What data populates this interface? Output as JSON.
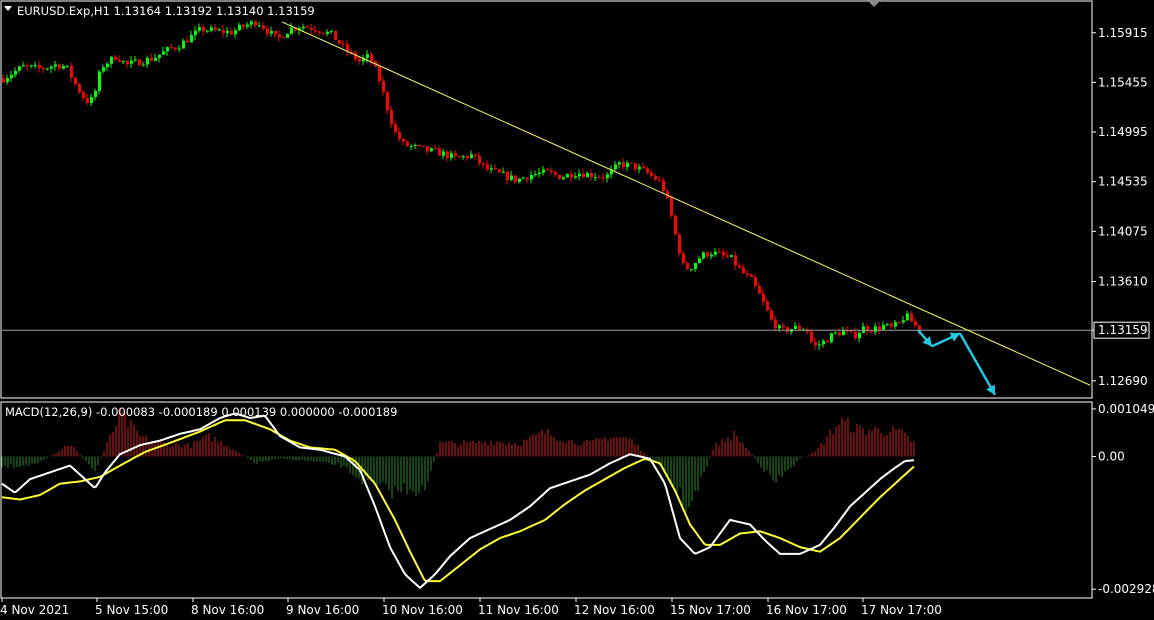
{
  "header": {
    "symbol_line": "EURUSD.Exp,H1  1.13164 1.13192 1.13140 1.13159"
  },
  "macd_header": "MACD(12,26,9) -0.000083 -0.000189 0.000139 0.000000 -0.000189",
  "colors": {
    "background": "#000000",
    "bull": "#00ff00",
    "bear": "#ff0000",
    "trendline": "#ffff66",
    "arrow": "#22c8e0",
    "macd_line": "#ffffff",
    "signal_line": "#ffff33",
    "hist_pos": "#d02020",
    "hist_neg": "#2a8a2a",
    "grid_border": "#ffffff"
  },
  "chart_data": [
    {
      "type": "candlestick",
      "title": "EURUSD.Exp,H1",
      "last_price": "1.13159",
      "ylim": [
        1.1254,
        1.162
      ],
      "y_ticks": [
        "1.15915",
        "1.15455",
        "1.14995",
        "1.14535",
        "1.14075",
        "1.13610",
        "1.13159",
        "1.12690"
      ],
      "x_ticks": [
        "4 Nov 2021",
        "5 Nov 15:00",
        "8 Nov 16:00",
        "9 Nov 16:00",
        "10 Nov 16:00",
        "11 Nov 16:00",
        "12 Nov 16:00",
        "15 Nov 17:00",
        "16 Nov 17:00",
        "17 Nov 17:00"
      ],
      "close_path": [
        [
          0,
          1.1548
        ],
        [
          12,
          1.1555
        ],
        [
          22,
          1.156
        ],
        [
          40,
          1.1558
        ],
        [
          55,
          1.1562
        ],
        [
          65,
          1.156
        ],
        [
          75,
          1.1542
        ],
        [
          85,
          1.1528
        ],
        [
          92,
          1.153
        ],
        [
          100,
          1.156
        ],
        [
          115,
          1.157
        ],
        [
          125,
          1.1562
        ],
        [
          140,
          1.1565
        ],
        [
          152,
          1.1568
        ],
        [
          165,
          1.1575
        ],
        [
          178,
          1.158
        ],
        [
          190,
          1.1588
        ],
        [
          200,
          1.1595
        ],
        [
          215,
          1.1593
        ],
        [
          230,
          1.1592
        ],
        [
          243,
          1.1598
        ],
        [
          256,
          1.1602
        ],
        [
          268,
          1.1592
        ],
        [
          276,
          1.1585
        ],
        [
          288,
          1.1595
        ],
        [
          300,
          1.1598
        ],
        [
          315,
          1.1595
        ],
        [
          330,
          1.159
        ],
        [
          345,
          1.1575
        ],
        [
          358,
          1.1565
        ],
        [
          368,
          1.157
        ],
        [
          378,
          1.1548
        ],
        [
          385,
          1.1525
        ],
        [
          393,
          1.15
        ],
        [
          402,
          1.1488
        ],
        [
          415,
          1.1485
        ],
        [
          428,
          1.1482
        ],
        [
          440,
          1.148
        ],
        [
          455,
          1.1475
        ],
        [
          470,
          1.1478
        ],
        [
          485,
          1.1465
        ],
        [
          500,
          1.146
        ],
        [
          515,
          1.1455
        ],
        [
          530,
          1.146
        ],
        [
          545,
          1.1462
        ],
        [
          560,
          1.1458
        ],
        [
          575,
          1.1462
        ],
        [
          590,
          1.146
        ],
        [
          605,
          1.1458
        ],
        [
          618,
          1.147
        ],
        [
          632,
          1.1468
        ],
        [
          645,
          1.1462
        ],
        [
          660,
          1.1452
        ],
        [
          668,
          1.143
        ],
        [
          675,
          1.14
        ],
        [
          683,
          1.1372
        ],
        [
          690,
          1.1375
        ],
        [
          700,
          1.1385
        ],
        [
          710,
          1.1388
        ],
        [
          720,
          1.1385
        ],
        [
          730,
          1.1382
        ],
        [
          740,
          1.137
        ],
        [
          750,
          1.1362
        ],
        [
          760,
          1.1345
        ],
        [
          770,
          1.1325
        ],
        [
          780,
          1.1315
        ],
        [
          792,
          1.1318
        ],
        [
          805,
          1.1318
        ],
        [
          812,
          1.13
        ],
        [
          822,
          1.1305
        ],
        [
          832,
          1.1312
        ],
        [
          842,
          1.1315
        ],
        [
          852,
          1.131
        ],
        [
          862,
          1.1318
        ],
        [
          872,
          1.1317
        ],
        [
          882,
          1.132
        ],
        [
          890,
          1.1318
        ],
        [
          898,
          1.1322
        ],
        [
          904,
          1.133
        ],
        [
          912,
          1.1322
        ],
        [
          918,
          1.1316
        ]
      ],
      "trendline": [
        [
          282,
          1.16015
        ],
        [
          1090,
          1.1265
        ]
      ],
      "projection_arrows": [
        [
          [
            918,
            1.1316
          ],
          [
            932,
            1.1301
          ]
        ],
        [
          [
            932,
            1.1301
          ],
          [
            960,
            1.1313
          ]
        ],
        [
          [
            960,
            1.1313
          ],
          [
            995,
            1.1256
          ]
        ]
      ]
    },
    {
      "type": "macd",
      "title": "MACD(12,26,9)",
      "ylim": [
        -0.0031,
        0.00118
      ],
      "y_ticks": [
        "0.001049",
        "0.00",
        "-0.002928"
      ],
      "zero_level": "0.00",
      "histogram_path": [
        [
          2,
          -0.00025
        ],
        [
          40,
          -0.00015
        ],
        [
          70,
          0.0003
        ],
        [
          95,
          -0.00035
        ],
        [
          120,
          0.00095
        ],
        [
          140,
          0.00045
        ],
        [
          160,
          0.0003
        ],
        [
          190,
          0.00025
        ],
        [
          210,
          0.00045
        ],
        [
          235,
          0.00015
        ],
        [
          255,
          -0.00015
        ],
        [
          280,
          -5e-05
        ],
        [
          310,
          -0.0001
        ],
        [
          340,
          -0.0002
        ],
        [
          370,
          -0.00065
        ],
        [
          395,
          -0.0008
        ],
        [
          410,
          -0.0007
        ],
        [
          425,
          -0.0008
        ],
        [
          440,
          0.0003
        ],
        [
          470,
          0.0003
        ],
        [
          490,
          0.00035
        ],
        [
          520,
          0.0003
        ],
        [
          545,
          0.00055
        ],
        [
          570,
          0.00035
        ],
        [
          590,
          0.0003
        ],
        [
          610,
          0.00045
        ],
        [
          630,
          0.0004
        ],
        [
          660,
          -0.00025
        ],
        [
          690,
          -0.0012
        ],
        [
          715,
          0.00025
        ],
        [
          735,
          0.0005
        ],
        [
          750,
          0.0001
        ],
        [
          775,
          -0.0006
        ],
        [
          800,
          -5e-05
        ],
        [
          815,
          0.0001
        ],
        [
          840,
          0.0008
        ],
        [
          860,
          0.0006
        ],
        [
          880,
          0.0006
        ],
        [
          900,
          0.00055
        ],
        [
          915,
          0.0003
        ]
      ],
      "macd_path": [
        [
          2,
          -0.0006
        ],
        [
          15,
          -0.0008
        ],
        [
          30,
          -0.0005
        ],
        [
          50,
          -0.00035
        ],
        [
          70,
          -0.0002
        ],
        [
          85,
          -0.0005
        ],
        [
          95,
          -0.0007
        ],
        [
          105,
          -0.00035
        ],
        [
          120,
          5e-05
        ],
        [
          140,
          0.00025
        ],
        [
          160,
          0.00035
        ],
        [
          180,
          0.0005
        ],
        [
          200,
          0.0006
        ],
        [
          220,
          0.00085
        ],
        [
          235,
          0.00095
        ],
        [
          250,
          0.00085
        ],
        [
          265,
          0.0009
        ],
        [
          280,
          0.00045
        ],
        [
          300,
          0.0002
        ],
        [
          320,
          0.00015
        ],
        [
          345,
          0.0
        ],
        [
          360,
          -0.0003
        ],
        [
          375,
          -0.0011
        ],
        [
          390,
          -0.002
        ],
        [
          405,
          -0.0026
        ],
        [
          420,
          -0.0029
        ],
        [
          435,
          -0.0026
        ],
        [
          450,
          -0.0022
        ],
        [
          470,
          -0.0018
        ],
        [
          490,
          -0.0016
        ],
        [
          510,
          -0.0014
        ],
        [
          530,
          -0.0011
        ],
        [
          550,
          -0.0007
        ],
        [
          570,
          -0.00055
        ],
        [
          590,
          -0.0004
        ],
        [
          610,
          -0.00015
        ],
        [
          630,
          5e-05
        ],
        [
          650,
          -5e-05
        ],
        [
          665,
          -0.0006
        ],
        [
          680,
          -0.0018
        ],
        [
          695,
          -0.00215
        ],
        [
          710,
          -0.002
        ],
        [
          730,
          -0.0014
        ],
        [
          750,
          -0.0015
        ],
        [
          765,
          -0.00185
        ],
        [
          780,
          -0.00215
        ],
        [
          800,
          -0.00215
        ],
        [
          820,
          -0.00195
        ],
        [
          835,
          -0.00155
        ],
        [
          850,
          -0.0011
        ],
        [
          865,
          -0.0008
        ],
        [
          880,
          -0.0005
        ],
        [
          895,
          -0.00025
        ],
        [
          905,
          -0.0001
        ],
        [
          915,
          -8e-05
        ]
      ],
      "signal_path": [
        [
          2,
          -0.0009
        ],
        [
          20,
          -0.00095
        ],
        [
          40,
          -0.00085
        ],
        [
          60,
          -0.0006
        ],
        [
          80,
          -0.00055
        ],
        [
          100,
          -0.00045
        ],
        [
          120,
          -0.0002
        ],
        [
          145,
          0.0001
        ],
        [
          170,
          0.0003
        ],
        [
          200,
          0.00055
        ],
        [
          225,
          0.0008
        ],
        [
          245,
          0.0008
        ],
        [
          270,
          0.0006
        ],
        [
          290,
          0.00035
        ],
        [
          310,
          0.0002
        ],
        [
          335,
          0.00015
        ],
        [
          355,
          -0.0001
        ],
        [
          375,
          -0.0006
        ],
        [
          395,
          -0.0014
        ],
        [
          410,
          -0.0021
        ],
        [
          425,
          -0.00275
        ],
        [
          440,
          -0.00275
        ],
        [
          460,
          -0.0024
        ],
        [
          480,
          -0.00205
        ],
        [
          500,
          -0.0018
        ],
        [
          520,
          -0.00165
        ],
        [
          545,
          -0.0014
        ],
        [
          565,
          -0.00105
        ],
        [
          585,
          -0.00075
        ],
        [
          605,
          -0.0005
        ],
        [
          625,
          -0.00025
        ],
        [
          645,
          -5e-05
        ],
        [
          660,
          -0.00015
        ],
        [
          675,
          -0.00075
        ],
        [
          690,
          -0.0015
        ],
        [
          705,
          -0.00195
        ],
        [
          720,
          -0.00195
        ],
        [
          740,
          -0.0017
        ],
        [
          760,
          -0.00165
        ],
        [
          780,
          -0.0018
        ],
        [
          800,
          -0.002
        ],
        [
          820,
          -0.0021
        ],
        [
          840,
          -0.0018
        ],
        [
          860,
          -0.00135
        ],
        [
          880,
          -0.0009
        ],
        [
          900,
          -0.0005
        ],
        [
          915,
          -0.0002
        ]
      ]
    }
  ]
}
